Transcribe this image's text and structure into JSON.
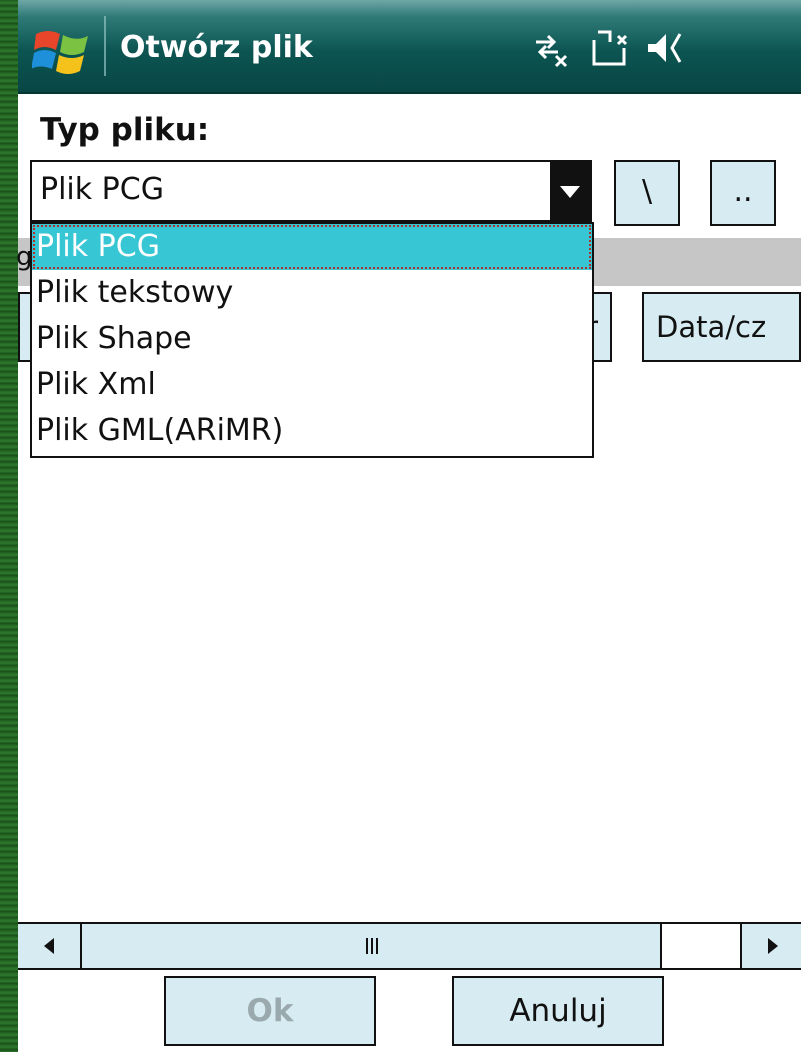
{
  "window": {
    "title": "Otwórz plik"
  },
  "status_icons": [
    "network-disconnected-icon",
    "sync-icon",
    "volume-icon"
  ],
  "file_type": {
    "label": "Typ pliku:",
    "selected": "Plik PCG",
    "options": [
      "Plik PCG",
      "Plik tekstowy",
      "Plik Shape",
      "Plik Xml",
      "Plik GML(ARiMR)"
    ]
  },
  "toolbar": {
    "root_label": "\\",
    "up_label": ".."
  },
  "path": {
    "visible_fragment": "g"
  },
  "columns": [
    {
      "label": "r"
    },
    {
      "label": "Data/cz"
    }
  ],
  "buttons": {
    "ok": "Ok",
    "cancel": "Anuluj"
  },
  "colors": {
    "title_bar": "#0c5552",
    "selection": "#36c6d4",
    "button_bg": "#d7ecf2"
  }
}
